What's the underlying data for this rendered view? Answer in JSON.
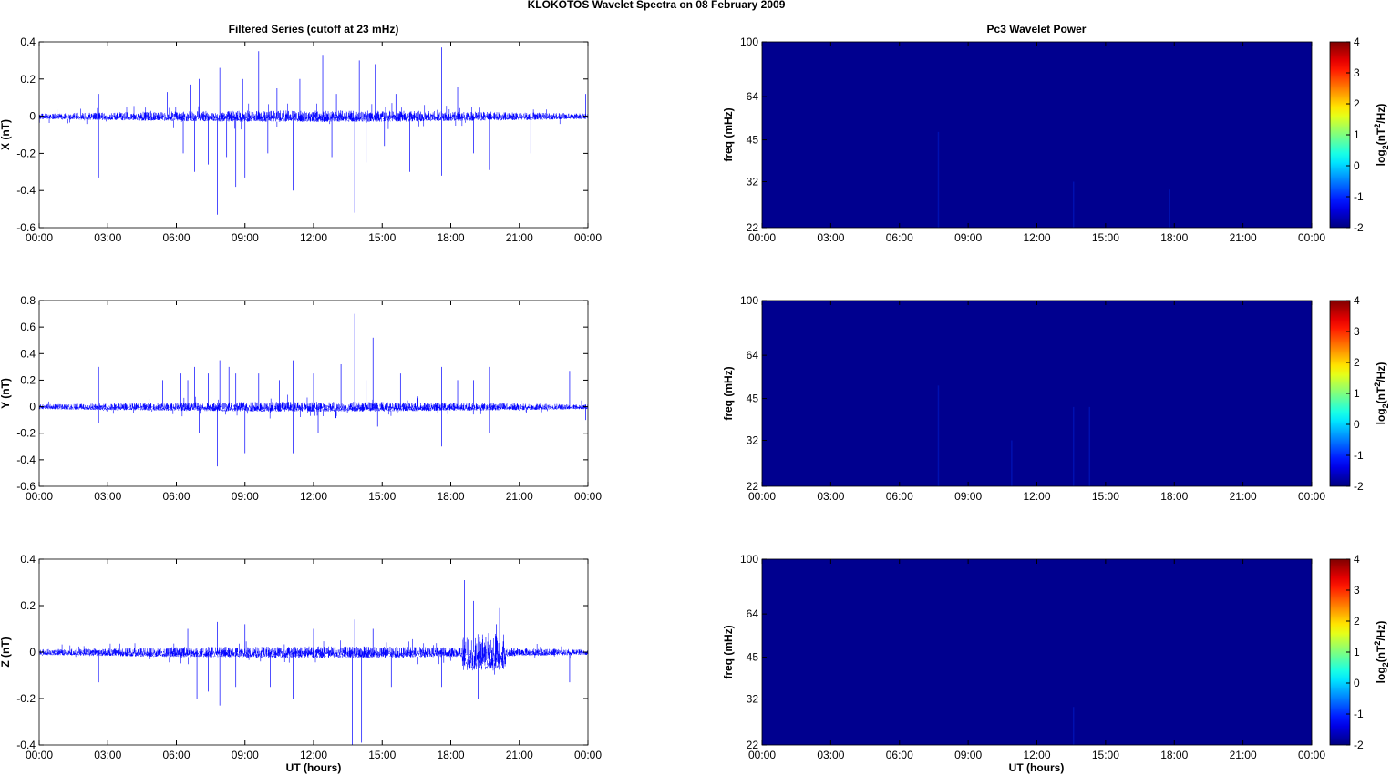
{
  "chart_data": {
    "title": "KLOKOTOS Wavelet Spectra on 08 February  2009",
    "time_ticks": [
      "00:00",
      "03:00",
      "06:00",
      "09:00",
      "12:00",
      "15:00",
      "18:00",
      "21:00",
      "00:00"
    ],
    "x_range_hours": [
      0,
      24
    ],
    "xlabel": "UT (hours)",
    "filtered": {
      "type": "line",
      "title": "Filtered Series (cutoff at 23 mHz)",
      "color": "#0000ff",
      "panels": [
        {
          "component": "X",
          "ylabel": "X (nT)",
          "ylim": [
            -0.6,
            0.4
          ],
          "yticks": [
            "-0.6",
            "-0.4",
            "-0.2",
            "0",
            "0.2",
            "0.4"
          ],
          "yvals": [
            -0.6,
            -0.4,
            -0.2,
            0,
            0.2,
            0.4
          ],
          "noise_amp": 0.025,
          "spikes": [
            [
              2.6,
              -0.33
            ],
            [
              2.6,
              0.12
            ],
            [
              4.8,
              -0.24
            ],
            [
              5.6,
              0.13
            ],
            [
              6.3,
              -0.2
            ],
            [
              6.6,
              0.17
            ],
            [
              6.8,
              -0.3
            ],
            [
              7.0,
              0.2
            ],
            [
              7.4,
              -0.26
            ],
            [
              7.8,
              -0.53
            ],
            [
              7.9,
              0.26
            ],
            [
              8.2,
              -0.22
            ],
            [
              8.6,
              -0.38
            ],
            [
              8.9,
              0.2
            ],
            [
              9.0,
              -0.33
            ],
            [
              9.6,
              0.35
            ],
            [
              10.0,
              -0.2
            ],
            [
              10.4,
              0.15
            ],
            [
              11.1,
              -0.4
            ],
            [
              11.4,
              0.2
            ],
            [
              12.4,
              0.33
            ],
            [
              12.8,
              -0.22
            ],
            [
              13.0,
              0.12
            ],
            [
              13.8,
              -0.52
            ],
            [
              14.0,
              0.3
            ],
            [
              14.3,
              -0.25
            ],
            [
              14.7,
              0.28
            ],
            [
              15.1,
              -0.16
            ],
            [
              15.6,
              0.12
            ],
            [
              16.2,
              -0.3
            ],
            [
              17.0,
              -0.2
            ],
            [
              17.6,
              0.37
            ],
            [
              17.6,
              -0.32
            ],
            [
              18.3,
              0.16
            ],
            [
              19.0,
              -0.2
            ],
            [
              19.7,
              -0.29
            ],
            [
              21.5,
              -0.2
            ],
            [
              23.3,
              -0.28
            ],
            [
              23.9,
              0.12
            ]
          ]
        },
        {
          "component": "Y",
          "ylabel": "Y (nT)",
          "ylim": [
            -0.6,
            0.8
          ],
          "yticks": [
            "-0.6",
            "-0.4",
            "-0.2",
            "0",
            "0.2",
            "0.4",
            "0.6",
            "0.8"
          ],
          "yvals": [
            -0.6,
            -0.4,
            -0.2,
            0,
            0.2,
            0.4,
            0.6,
            0.8
          ],
          "noise_amp": 0.03,
          "spikes": [
            [
              2.6,
              0.3
            ],
            [
              2.6,
              -0.12
            ],
            [
              4.8,
              0.2
            ],
            [
              5.4,
              0.2
            ],
            [
              6.2,
              0.25
            ],
            [
              6.5,
              0.2
            ],
            [
              6.8,
              0.3
            ],
            [
              7.0,
              -0.2
            ],
            [
              7.4,
              0.25
            ],
            [
              7.8,
              -0.45
            ],
            [
              7.9,
              0.35
            ],
            [
              8.3,
              0.3
            ],
            [
              8.6,
              0.25
            ],
            [
              9.0,
              -0.35
            ],
            [
              9.6,
              0.25
            ],
            [
              10.5,
              0.2
            ],
            [
              11.1,
              0.35
            ],
            [
              11.1,
              -0.35
            ],
            [
              12.0,
              0.25
            ],
            [
              12.2,
              -0.2
            ],
            [
              13.2,
              0.32
            ],
            [
              13.8,
              0.7
            ],
            [
              14.3,
              0.2
            ],
            [
              14.6,
              0.52
            ],
            [
              14.8,
              -0.15
            ],
            [
              15.8,
              0.25
            ],
            [
              17.6,
              0.3
            ],
            [
              17.6,
              -0.3
            ],
            [
              18.3,
              0.2
            ],
            [
              19.0,
              0.2
            ],
            [
              19.7,
              0.3
            ],
            [
              19.7,
              -0.2
            ],
            [
              23.2,
              0.27
            ],
            [
              23.9,
              -0.1
            ]
          ]
        },
        {
          "component": "Z",
          "ylabel": "Z (nT)",
          "ylim": [
            -0.4,
            0.4
          ],
          "yticks": [
            "-0.4",
            "-0.2",
            "0",
            "0.2",
            "0.4"
          ],
          "yvals": [
            -0.4,
            -0.2,
            0,
            0.2,
            0.4
          ],
          "noise_amp": 0.02,
          "spikes": [
            [
              2.6,
              -0.13
            ],
            [
              4.8,
              -0.14
            ],
            [
              6.5,
              0.1
            ],
            [
              6.9,
              -0.2
            ],
            [
              7.4,
              -0.17
            ],
            [
              7.8,
              0.13
            ],
            [
              7.9,
              -0.23
            ],
            [
              8.6,
              -0.15
            ],
            [
              9.0,
              0.12
            ],
            [
              10.1,
              -0.15
            ],
            [
              11.1,
              -0.2
            ],
            [
              12.0,
              0.1
            ],
            [
              13.7,
              -0.4
            ],
            [
              13.8,
              0.14
            ],
            [
              14.1,
              -0.39
            ],
            [
              14.6,
              0.1
            ],
            [
              15.4,
              -0.15
            ],
            [
              17.6,
              -0.15
            ],
            [
              18.6,
              0.31
            ],
            [
              19.0,
              0.22
            ],
            [
              19.2,
              -0.2
            ],
            [
              20.0,
              0.12
            ],
            [
              23.2,
              -0.13
            ]
          ],
          "burst": [
            18.5,
            20.4,
            0.08
          ]
        }
      ]
    },
    "wavelet": {
      "type": "heatmap",
      "title": "Pc3 Wavelet Power",
      "ylabel": "freq (mHz)",
      "ylim": [
        22,
        100
      ],
      "yscale": "log",
      "yticks": [
        "22",
        "32",
        "45",
        "64",
        "100"
      ],
      "yvals": [
        22,
        32,
        45,
        64,
        100
      ],
      "background_value": -2,
      "base_color": "#00008f",
      "colorbar": {
        "label": "log2(nT2/Hz)",
        "range": [
          -2,
          4
        ],
        "ticks": [
          "-2",
          "-1",
          "0",
          "1",
          "2",
          "3",
          "4"
        ],
        "tvals": [
          -2,
          -1,
          0,
          1,
          2,
          3,
          4
        ]
      },
      "panels": [
        {
          "component": "X",
          "streaks": [
            [
              7.7,
              48
            ],
            [
              13.6,
              32
            ],
            [
              17.8,
              30
            ]
          ]
        },
        {
          "component": "Y",
          "streaks": [
            [
              7.7,
              50
            ],
            [
              10.9,
              32
            ],
            [
              13.6,
              42
            ],
            [
              14.3,
              42
            ]
          ]
        },
        {
          "component": "Z",
          "streaks": [
            [
              13.6,
              30
            ]
          ]
        }
      ]
    }
  }
}
